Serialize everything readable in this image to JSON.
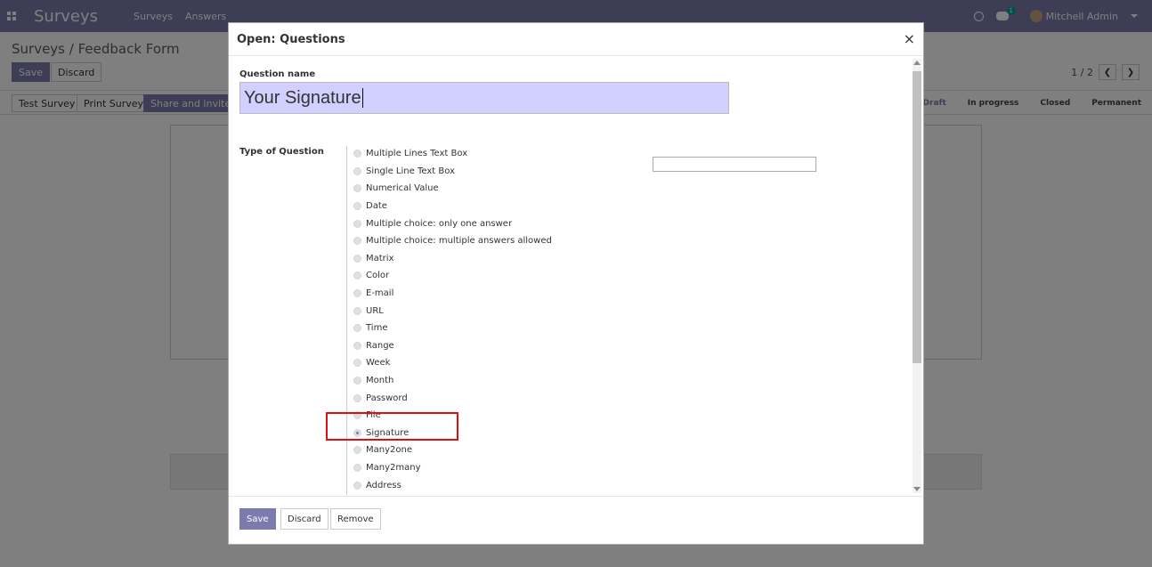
{
  "navbar": {
    "app_title": "Surveys",
    "menu": [
      "Surveys",
      "Answers"
    ],
    "chat_badge": "1",
    "user_name": "Mitchell Admin"
  },
  "control_panel": {
    "breadcrumb": "Surveys / Feedback Form",
    "save_label": "Save",
    "discard_label": "Discard",
    "pager": "1 / 2"
  },
  "statusbar": {
    "buttons": [
      "Test Survey",
      "Print Survey",
      "Share and invite by"
    ],
    "stages": [
      "Draft",
      "In progress",
      "Closed",
      "Permanent"
    ],
    "active_stage": "Draft"
  },
  "modal": {
    "title": "Open: Questions",
    "question_name_label": "Question name",
    "question_name_value": "Your Signature",
    "type_label": "Type of Question",
    "types": [
      "Multiple Lines Text Box",
      "Single Line Text Box",
      "Numerical Value",
      "Date",
      "Multiple choice: only one answer",
      "Multiple choice: multiple answers allowed",
      "Matrix",
      "Color",
      "E-mail",
      "URL",
      "Time",
      "Range",
      "Week",
      "Month",
      "Password",
      "File",
      "Signature",
      "Many2one",
      "Many2many",
      "Address"
    ],
    "selected_type": "Signature",
    "footer": {
      "save_label": "Save",
      "discard_label": "Discard",
      "remove_label": "Remove"
    }
  },
  "colors": {
    "brand": "#7c7bad",
    "input_highlight": "#d1d0ff",
    "annotation_red": "#e01010"
  }
}
